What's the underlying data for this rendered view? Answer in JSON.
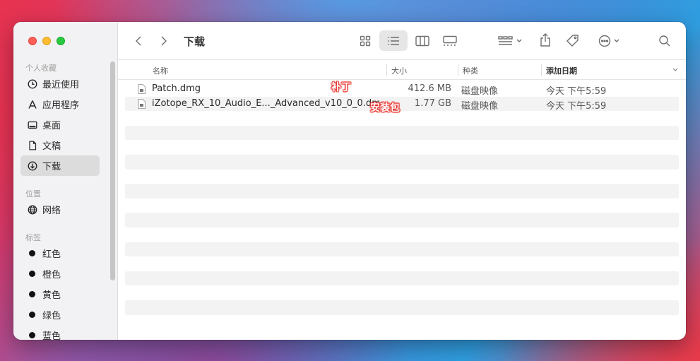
{
  "window": {
    "title": "下载"
  },
  "sidebar": {
    "sections": [
      {
        "label": "个人收藏"
      },
      {
        "label": "位置"
      },
      {
        "label": "标签"
      }
    ],
    "favorites": [
      {
        "label": "最近使用",
        "icon": "clock-icon"
      },
      {
        "label": "应用程序",
        "icon": "applications-icon"
      },
      {
        "label": "桌面",
        "icon": "desktop-icon"
      },
      {
        "label": "文稿",
        "icon": "document-icon"
      },
      {
        "label": "下载",
        "icon": "download-icon",
        "active": true
      }
    ],
    "locations": [
      {
        "label": "网络",
        "icon": "globe-icon"
      }
    ],
    "tags": [
      {
        "label": "红色",
        "color": "#111111"
      },
      {
        "label": "橙色",
        "color": "#111111"
      },
      {
        "label": "黄色",
        "color": "#111111"
      },
      {
        "label": "绿色",
        "color": "#111111"
      },
      {
        "label": "蓝色",
        "color": "#111111"
      }
    ]
  },
  "columns": {
    "name": "名称",
    "size": "大小",
    "kind": "种类",
    "date": "添加日期"
  },
  "files": [
    {
      "name": "Patch.dmg",
      "size": "412.6 MB",
      "kind": "磁盘映像",
      "date": "今天 下午5:59"
    },
    {
      "name": "iZotope_RX_10_Audio_E..._Advanced_v10_0_0.dmg",
      "size": "1.77 GB",
      "kind": "磁盘映像",
      "date": "今天 下午5:59"
    }
  ],
  "annotations": {
    "patch": "补丁",
    "installer": "安装包"
  },
  "colors": {
    "close": "#fe5f57",
    "minimize": "#febc2e",
    "zoom": "#28c840"
  }
}
